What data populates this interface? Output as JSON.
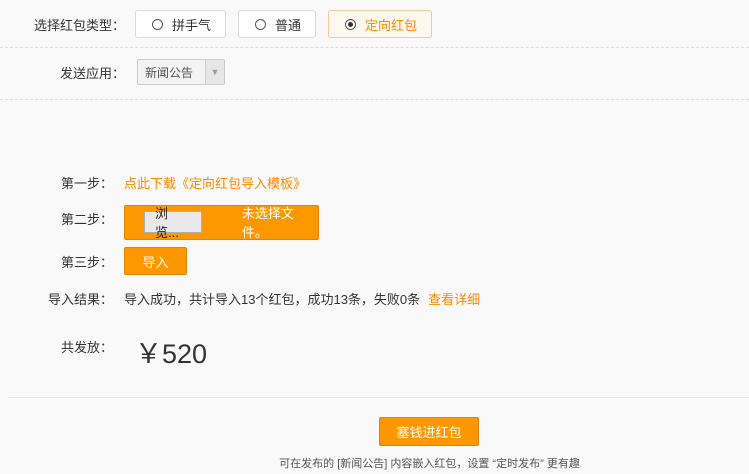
{
  "type_row": {
    "label": "选择红包类型：",
    "options": [
      {
        "label": "拼手气",
        "selected": false
      },
      {
        "label": "普通",
        "selected": false
      },
      {
        "label": "定向红包",
        "selected": true
      }
    ]
  },
  "app_row": {
    "label": "发送应用：",
    "selected": "新闻公告"
  },
  "steps": {
    "step1_label": "第一步：",
    "step1_link": "点此下载《定向红包导入模板》",
    "step2_label": "第二步：",
    "browse_label": "浏览...",
    "file_status": "未选择文件。",
    "step3_label": "第三步：",
    "import_label": "导入",
    "result_label": "导入结果：",
    "result_text": "导入成功，共计导入13个红包，成功13条，失败0条",
    "result_link": "查看详细"
  },
  "total": {
    "label": "共发放：",
    "amount": "￥520"
  },
  "submit": {
    "label": "塞钱进红包"
  },
  "hint": "可在发布的 [新闻公告] 内容嵌入红包，设置 “定时发布” 更有趣",
  "colors": {
    "accent": "#ff9700",
    "link": "#ff8a00"
  }
}
